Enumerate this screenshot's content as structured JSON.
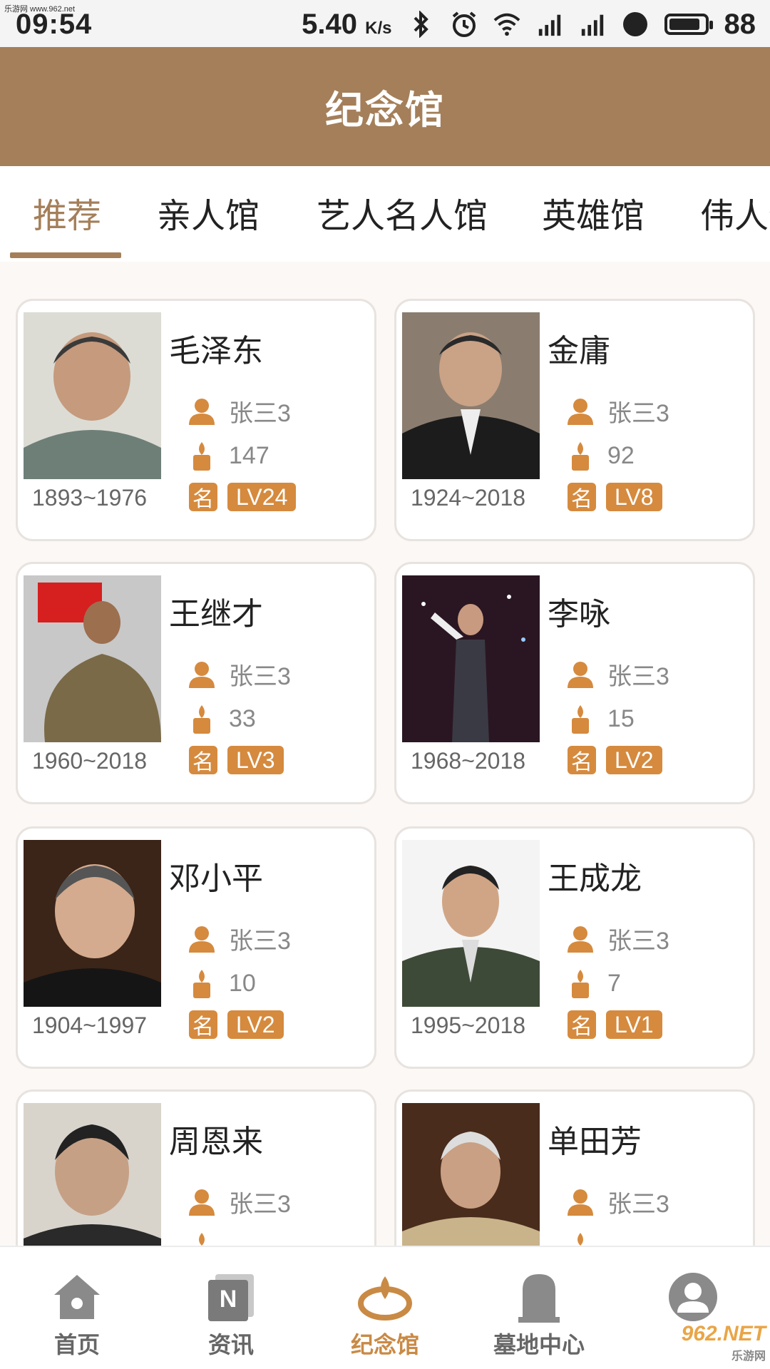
{
  "status_bar": {
    "site_tag": "乐游网 www.962.net",
    "time": "09:54",
    "speed": "5.40",
    "speed_unit": "K/s",
    "battery": "88",
    "battery_level_percent": 88
  },
  "header": {
    "title": "纪念馆"
  },
  "tabs": [
    {
      "label": "推荐"
    },
    {
      "label": "亲人馆"
    },
    {
      "label": "艺人名人馆"
    },
    {
      "label": "英雄馆"
    },
    {
      "label": "伟人馆"
    }
  ],
  "cards": [
    {
      "name": "毛泽东",
      "owner": "张三3",
      "candles": "147",
      "dates": "1893~1976",
      "ming": "名",
      "level": "LV24"
    },
    {
      "name": "金庸",
      "owner": "张三3",
      "candles": "92",
      "dates": "1924~2018",
      "ming": "名",
      "level": "LV8"
    },
    {
      "name": "王继才",
      "owner": "张三3",
      "candles": "33",
      "dates": "1960~2018",
      "ming": "名",
      "level": "LV3"
    },
    {
      "name": "李咏",
      "owner": "张三3",
      "candles": "15",
      "dates": "1968~2018",
      "ming": "名",
      "level": "LV2"
    },
    {
      "name": "邓小平",
      "owner": "张三3",
      "candles": "10",
      "dates": "1904~1997",
      "ming": "名",
      "level": "LV2"
    },
    {
      "name": "王成龙",
      "owner": "张三3",
      "candles": "7",
      "dates": "1995~2018",
      "ming": "名",
      "level": "LV1"
    },
    {
      "name": "周恩来",
      "owner": "张三3",
      "candles": "",
      "dates": "",
      "ming": "",
      "level": ""
    },
    {
      "name": "单田芳",
      "owner": "张三3",
      "candles": "",
      "dates": "",
      "ming": "",
      "level": ""
    }
  ],
  "bottom_nav": [
    {
      "label": "首页",
      "icon": "home-icon"
    },
    {
      "label": "资讯",
      "icon": "news-icon"
    },
    {
      "label": "纪念馆",
      "icon": "memorial-icon"
    },
    {
      "label": "墓地中心",
      "icon": "tombstone-icon"
    },
    {
      "label": "",
      "icon": "profile-icon"
    }
  ],
  "watermark": {
    "main": "962.NET",
    "sub": "乐游网"
  },
  "colors": {
    "brand": "#a47f59",
    "badge": "#d58a3e",
    "active_nav": "#c98a45"
  }
}
